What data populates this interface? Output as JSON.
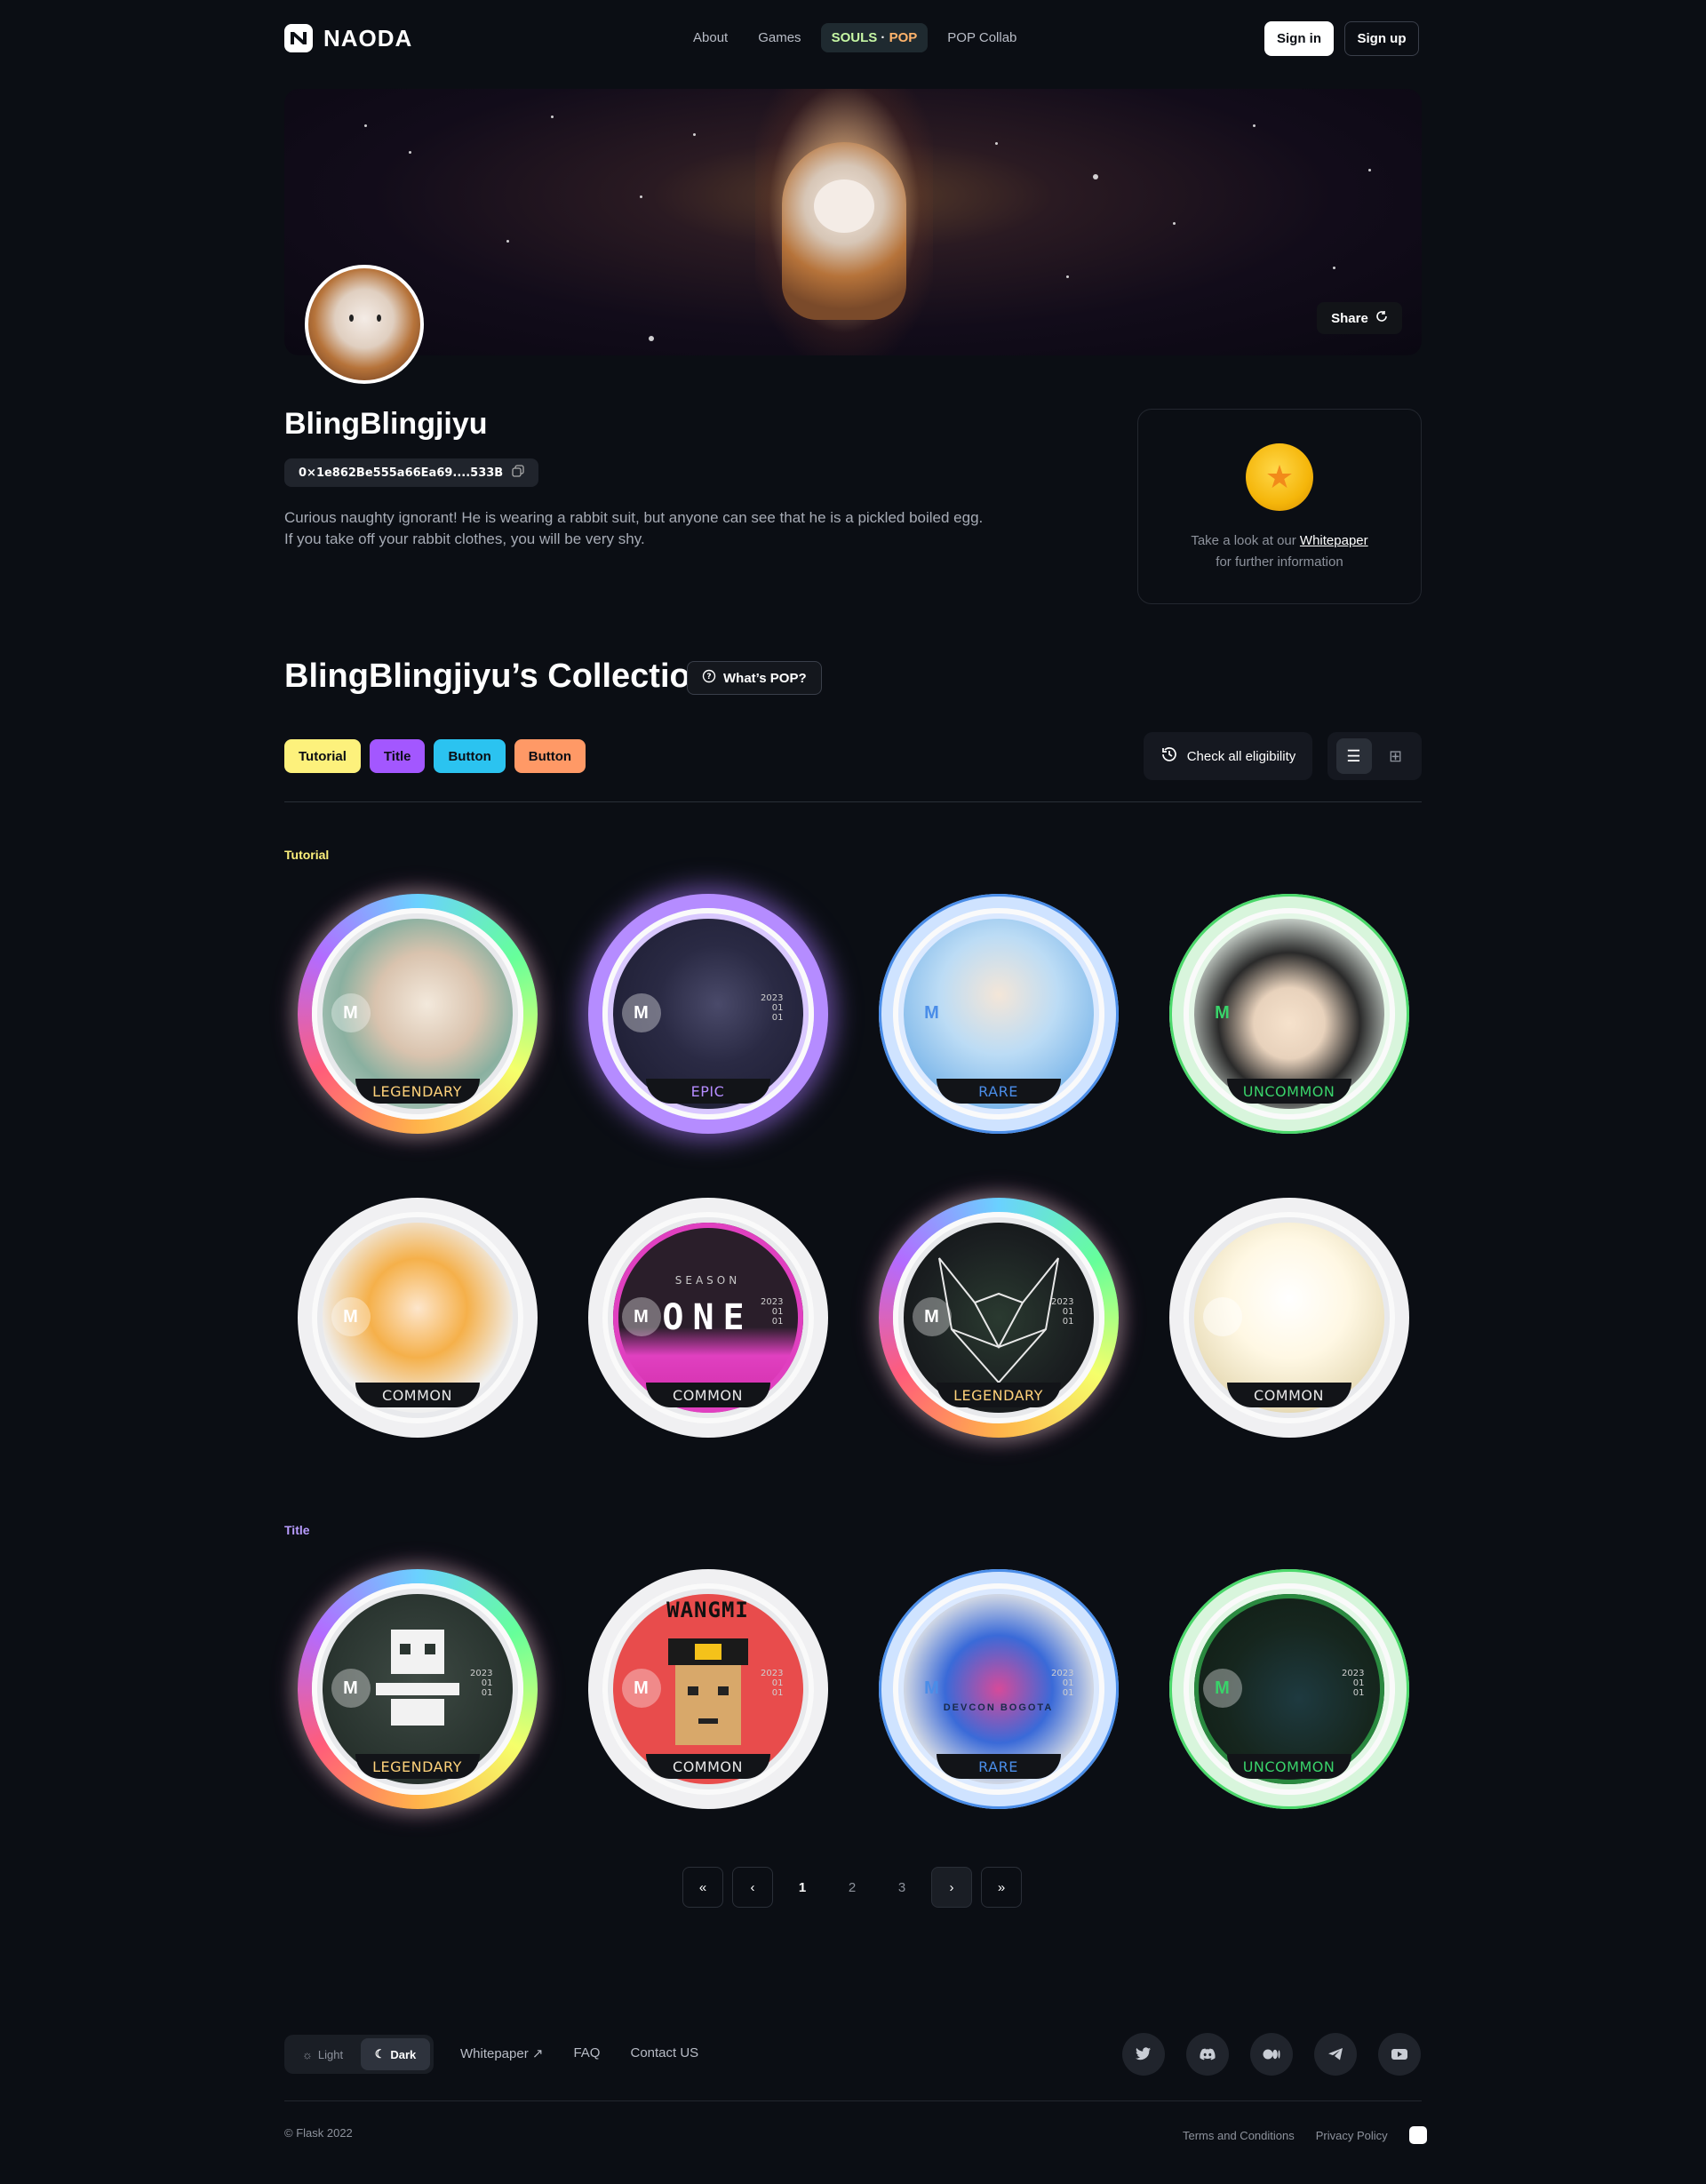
{
  "header": {
    "logo_text": "NAODA",
    "nav": [
      {
        "label": "About"
      },
      {
        "label": "Games"
      },
      {
        "label_a": "SOULS",
        "label_sep": " · ",
        "label_b": "POP"
      },
      {
        "label": "POP Collab"
      }
    ],
    "sign_in": "Sign in",
    "sign_up": "Sign up"
  },
  "banner": {
    "share_label": "Share"
  },
  "profile": {
    "name": "BlingBlingjiyu",
    "wallet": "0×1e862Be555a66Ea69....533B",
    "bio_line1": "Curious naughty ignorant! He is wearing a rabbit suit, but anyone can see that he is a pickled boiled egg.",
    "bio_line2": "If you take off your rabbit clothes, you will be very shy."
  },
  "whitepaper_card": {
    "text_before": "Take a look at our",
    "link": "Whitepaper",
    "text_after": "for further information"
  },
  "collection": {
    "title": "BlingBlingjiyu’s Collection",
    "whats_pop": "What’s POP?",
    "tags": [
      {
        "label": "Tutorial",
        "color": "#fdf17c"
      },
      {
        "label": "Title",
        "color": "#a357ff"
      },
      {
        "label": "Button",
        "color": "#2bc3f0"
      },
      {
        "label": "Button",
        "color": "#ff9966"
      }
    ],
    "check_all": "Check all eligibility",
    "sections": [
      {
        "label": "Tutorial",
        "color": "#fdf17c",
        "badges": [
          {
            "rarity": "LEGENDARY",
            "style": "rainbow",
            "art": "boy-on-sofa",
            "date": ""
          },
          {
            "rarity": "EPIC",
            "style": "epic",
            "art": "space-creature",
            "date": "2023\n01\n01"
          },
          {
            "rarity": "RARE",
            "style": "blue",
            "art": "skateboard-boy",
            "date": ""
          },
          {
            "rarity": "UNCOMMON",
            "style": "green",
            "art": "penguin-kid",
            "date": ""
          },
          {
            "rarity": "COMMON",
            "style": "white",
            "art": "yellow-rabbit",
            "date": ""
          },
          {
            "rarity": "COMMON",
            "style": "pink",
            "art": "season-one",
            "date": "2023\n01\n01",
            "overlay_top": "SEASON",
            "overlay_main": "ONE"
          },
          {
            "rarity": "LEGENDARY",
            "style": "rainbow",
            "art": "polygon-fox",
            "date": "2023\n01\n01"
          },
          {
            "rarity": "COMMON",
            "style": "white",
            "art": "light-burst",
            "date": ""
          }
        ]
      },
      {
        "label": "Title",
        "color": "#b89cff",
        "badges": [
          {
            "rarity": "LEGENDARY",
            "style": "rainbow",
            "art": "pixel-skull",
            "date": "2023\n01\n01"
          },
          {
            "rarity": "COMMON",
            "style": "red",
            "art": "wangmi-pixel",
            "date": "2023\n01\n01",
            "overlay_top": "WANGMI"
          },
          {
            "rarity": "RARE",
            "style": "blue",
            "art": "devcon-bogota",
            "date": "2023\n01\n01",
            "overlay_text": "DEVCON BOGOTA"
          },
          {
            "rarity": "UNCOMMON",
            "style": "green",
            "art": "dark-green",
            "date": "2023\n01\n01"
          }
        ]
      }
    ]
  },
  "pagination": {
    "pages": [
      "1",
      "2",
      "3"
    ],
    "current": "1"
  },
  "footer": {
    "theme_light": "Light",
    "theme_dark": "Dark",
    "links": [
      "Whitepaper",
      "FAQ",
      "Contact US"
    ],
    "socials": [
      "twitter-icon",
      "discord-icon",
      "medium-icon",
      "telegram-icon",
      "youtube-icon"
    ],
    "copyright": "© Flask 2022",
    "terms": "Terms and Conditions",
    "privacy": "Privacy Policy"
  },
  "colors": {
    "bg": "#0b0e14",
    "accent_legendary": "#ffd27a",
    "accent_epic": "#b58cff",
    "accent_rare": "#4a8de8",
    "accent_uncommon": "#39d36a"
  }
}
